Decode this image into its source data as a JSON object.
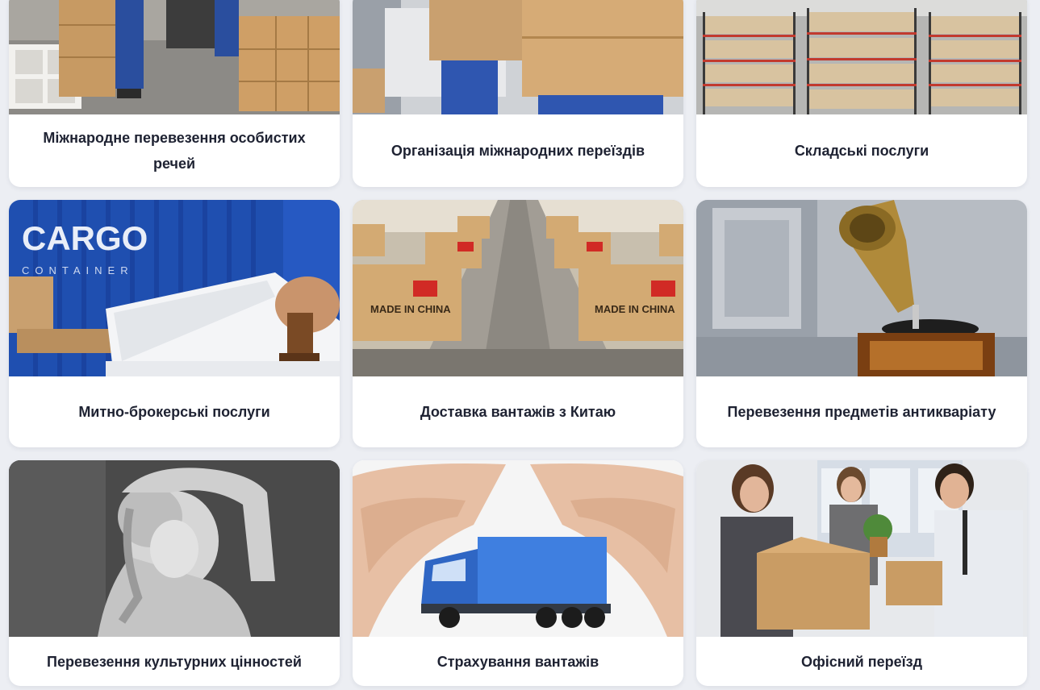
{
  "cards": [
    {
      "title": "Міжнародне перевезення особистих речей",
      "image": "movers-loading-boxes-photo"
    },
    {
      "title": "Організація міжнародних переїздів",
      "image": "carrying-boxes-photo"
    },
    {
      "title": "Складські послуги",
      "image": "warehouse-shelves-photo"
    },
    {
      "title": "Митно-брокерські послуги",
      "image": "cargo-container-stamp-photo"
    },
    {
      "title": "Доставка вантажів з Китаю",
      "image": "conveyor-boxes-china-photo"
    },
    {
      "title": "Перевезення предметів антикваріату",
      "image": "gramophone-photo"
    },
    {
      "title": "Перевезення культурних цінностей",
      "image": "classical-statue-photo"
    },
    {
      "title": "Страхування вантажів",
      "image": "hands-truck-photo"
    },
    {
      "title": "Офісний переїзд",
      "image": "office-moving-people-photo"
    }
  ],
  "image_text": {
    "cargo_word": "CARGO",
    "container_word": "CONTAINER",
    "made_in_china": "MADE IN CHINA"
  },
  "colors": {
    "page_bg": "#eceef3",
    "card_bg": "#ffffff",
    "title": "#1e2232"
  }
}
